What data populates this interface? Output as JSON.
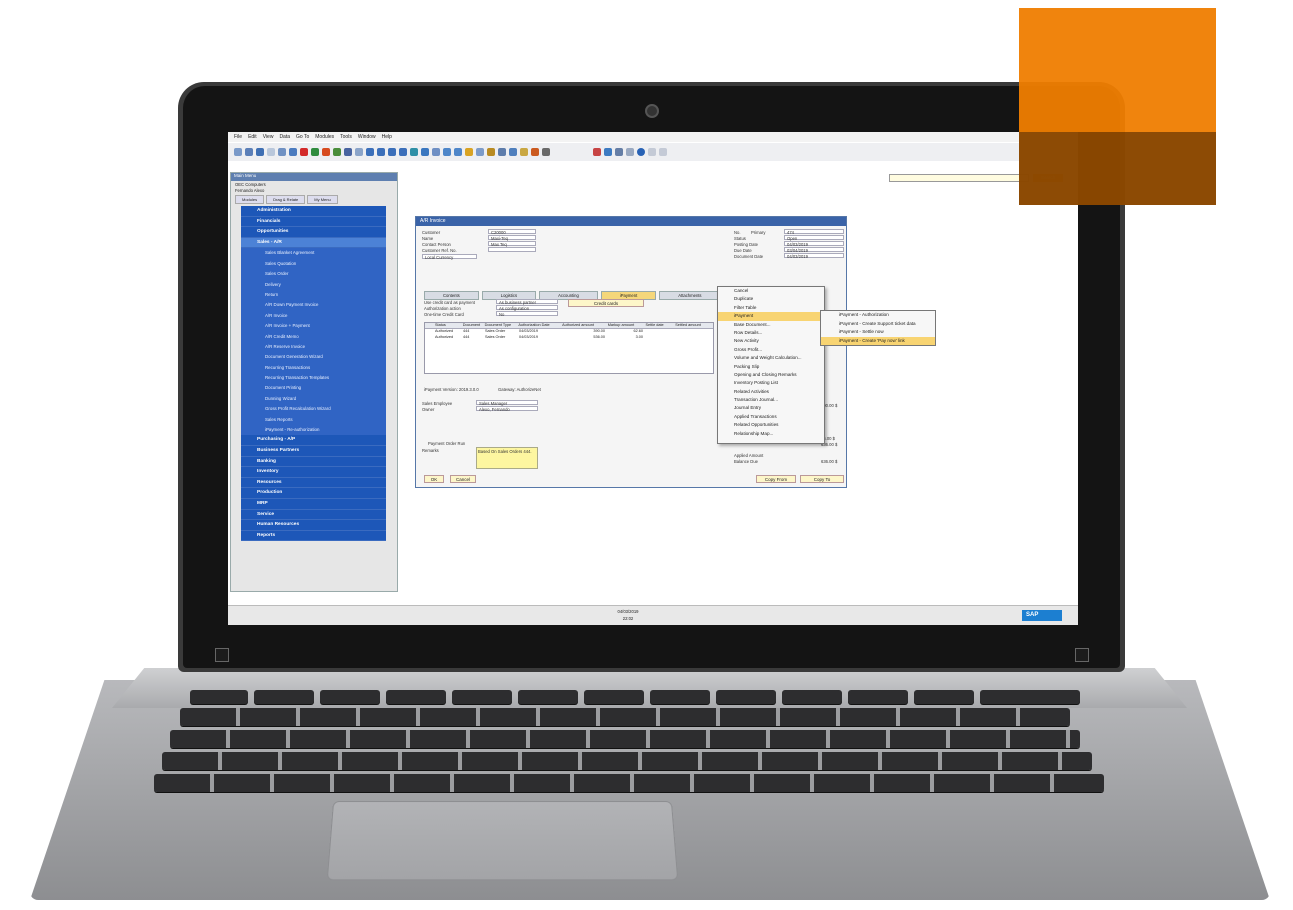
{
  "menubar": [
    "File",
    "Edit",
    "View",
    "Data",
    "Go To",
    "Modules",
    "Tools",
    "Window",
    "Help"
  ],
  "main_menu": {
    "title": "Main Menu",
    "company": "OEC Computers",
    "user": "Fernando Alexo",
    "tabs": [
      "Modules",
      "Drag & Relate",
      "My Menu"
    ],
    "modules_before": [
      "Administration",
      "Financials",
      "Opportunities"
    ],
    "selected": "Sales - A/R",
    "sales_items": [
      "Sales Blanket Agreement",
      "Sales Quotation",
      "Sales Order",
      "Delivery",
      "Return",
      "A/R Down Payment Invoice",
      "A/R Invoice",
      "A/R Invoice + Payment",
      "A/R Credit Memo",
      "A/R Reserve Invoice",
      "Document Generation Wizard",
      "Recurring Transactions",
      "Recurring Transaction Templates",
      "Document Printing",
      "Dunning Wizard",
      "Gross Profit Recalculation Wizard",
      "Sales Reports",
      "iPayment - Re-authorization"
    ],
    "modules_after": [
      "Purchasing - A/P",
      "Business Partners",
      "Banking",
      "Inventory",
      "Resources",
      "Production",
      "MRP",
      "Service",
      "Human Resources",
      "Reports"
    ]
  },
  "search": {
    "placeholder": "Search",
    "button": "Search"
  },
  "invoice": {
    "title": "A/R Invoice",
    "customer_label": "Customer",
    "customer": "C20000",
    "name_label": "Name",
    "name": "Maxi-Teq",
    "contact_label": "Contact Person",
    "contact": "Max Teq",
    "custref_label": "Customer Ref. No.",
    "currency": "Local Currency",
    "no_label": "No.",
    "no_series": "Primary",
    "no": "474",
    "status_label": "Status",
    "status": "Open",
    "posting_label": "Posting Date",
    "posting": "04/03/2019",
    "due_label": "Due Date",
    "due": "03/04/2019",
    "docdate_label": "Document Date",
    "docdate": "04/03/2019",
    "tabs": [
      "Contents",
      "Logistics",
      "Accounting",
      "iPayment",
      "Attachments"
    ],
    "use_cc": "Use credit card as payment",
    "use_cc_val": "As business partner",
    "auth_action": "Authorization action",
    "auth_action_val": "As configuration",
    "onetime": "One-time Credit Card",
    "onetime_val": "No",
    "credit_btn": "Credit cards",
    "grid_headers": [
      "Status",
      "Document",
      "Document Type",
      "Authorization Date",
      "Authorized amount",
      "Markup amount",
      "Settle date",
      "Settled amount"
    ],
    "grid_rows": [
      [
        "Authorized",
        "444",
        "Sales Order",
        "04/03/2019",
        "390.00",
        "62.60"
      ],
      [
        "Authorized",
        "444",
        "Sales Order",
        "04/03/2019",
        "536.00",
        "3.00"
      ]
    ],
    "version": "iPayment Version: 2019.3.0.0",
    "gateway": "Gateway: AuthorizeNet",
    "sales_emp_label": "Sales Employee",
    "sales_emp": "Sales Manager",
    "owner_label": "Owner",
    "owner": "Alexo, Fernando",
    "paydue_label": "Payment Order Run",
    "remarks_label": "Remarks",
    "remarks": "Based On Sales Orders 444.",
    "ok": "OK",
    "cancel": "Cancel",
    "copy_from": "Copy From",
    "copy_to": "Copy To",
    "total1": "600.00 $",
    "total2": "36.00 $",
    "total3": "636.00 $",
    "applied_label": "Applied Amount",
    "balance_label": "Balance Due",
    "balance": "636.00 $"
  },
  "context_menu": [
    "Cancel",
    "Duplicate",
    "Filter Table",
    "iPayment",
    "Base Document...",
    "Row Details...",
    "New Activity",
    "Gross Profit...",
    "Volume and Weight Calculation...",
    "Packing Slip",
    "Opening and Closing Remarks",
    "Inventory Posting List",
    "Related Activities",
    "Transaction Journal...",
    "Journal Entry",
    "Applied Transactions",
    "Related Opportunities",
    "Relationship Map..."
  ],
  "submenu": [
    "iPayment - Authorization",
    "iPayment - Create Support ticket data",
    "iPayment - Settle now",
    "iPayment - Create 'Pay now' link"
  ],
  "statusbar": {
    "date": "04/03/2019",
    "time": "22:02",
    "logo": "SAP"
  }
}
